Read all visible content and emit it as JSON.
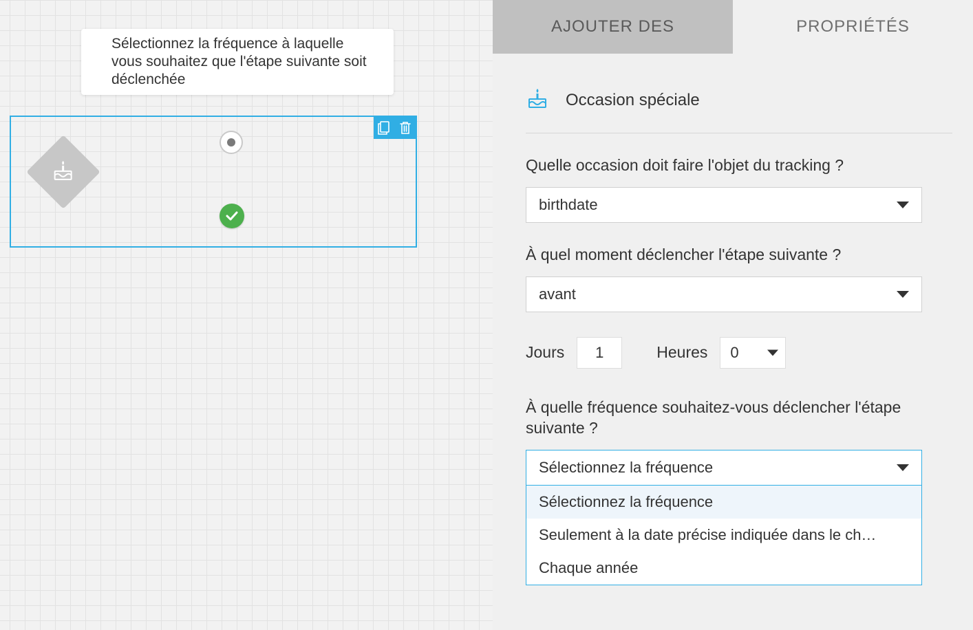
{
  "canvas": {
    "node": {
      "text": "Sélectionnez la fréquence à laquelle vous souhaitez que l'étape suivante soit déclenchée"
    }
  },
  "panel": {
    "tabs": {
      "add": "AJOUTER DES",
      "props": "PROPRIÉTÉS"
    },
    "section": {
      "title": "Occasion spéciale"
    },
    "q1": {
      "label": "Quelle occasion doit faire l'objet du tracking ?",
      "value": "birthdate"
    },
    "q2": {
      "label": "À quel moment déclencher l'étape suivante ?",
      "value": "avant"
    },
    "timing": {
      "days_label": "Jours",
      "days_value": "1",
      "hours_label": "Heures",
      "hours_value": "0"
    },
    "q3": {
      "label": "À quelle fréquence souhaitez-vous déclencher l'étape suivante ?",
      "value": "Sélectionnez la fréquence",
      "options": [
        "Sélectionnez la fréquence",
        "Seulement à la date précise indiquée dans le ch…",
        "Chaque année"
      ]
    }
  }
}
